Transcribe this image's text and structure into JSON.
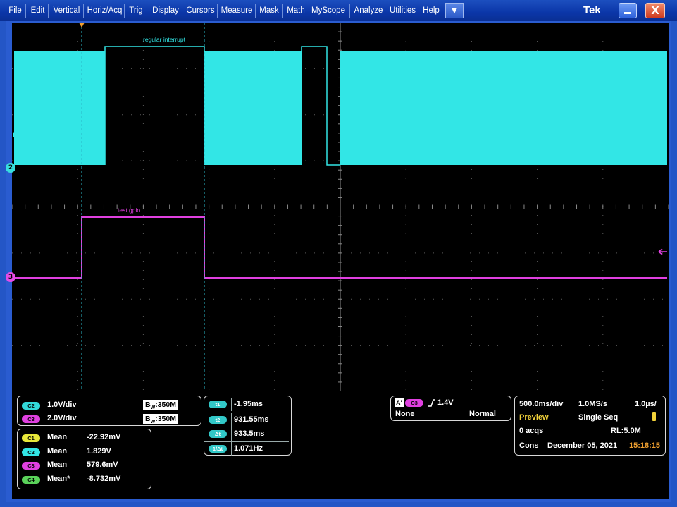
{
  "menu": {
    "items": [
      "File",
      "Edit",
      "Vertical",
      "Horiz/Acq",
      "Trig",
      "Display",
      "Cursors",
      "Measure",
      "Mask",
      "Math",
      "MyScope",
      "Analyze",
      "Utilities",
      "Help"
    ],
    "dropdown_glyph": "▼",
    "brand": "Tek",
    "minimize_icon": "minimize-icon",
    "close_glyph": "X"
  },
  "colors": {
    "ch2": "#32e6e6",
    "ch3": "#e040e0",
    "ch1": "#e8e83a",
    "ch4": "#5ad25a"
  },
  "waveform": {
    "ch2_label": "regular interrupt",
    "ch3_label": "test gpio",
    "ch2_marker": "2",
    "ch3_marker": "3"
  },
  "channels": {
    "c2": {
      "pill": "C2",
      "scale": "1.0V/div",
      "bw": "350M",
      "bw_prefix": "B",
      "bw_sub": "W"
    },
    "c3": {
      "pill": "C3",
      "scale": "2.0V/div",
      "bw": "350M",
      "bw_prefix": "B",
      "bw_sub": "W"
    }
  },
  "measurements": [
    {
      "pill": "C1",
      "label": "Mean",
      "value": "-22.92mV"
    },
    {
      "pill": "C2",
      "label": "Mean",
      "value": "1.829V"
    },
    {
      "pill": "C3",
      "label": "Mean",
      "value": "579.6mV"
    },
    {
      "pill": "C4",
      "label": "Mean*",
      "value": "-8.732mV"
    }
  ],
  "cursors": [
    {
      "pill": "t1",
      "value": "-1.95ms"
    },
    {
      "pill": "t2",
      "value": "931.55ms"
    },
    {
      "pill": "Δt",
      "value": "933.5ms"
    },
    {
      "pill": "1/Δt",
      "value": "1.071Hz"
    }
  ],
  "trigger": {
    "a_label": "A'",
    "source": "C3",
    "level": "1.4V",
    "coupling": "None",
    "mode": "Normal"
  },
  "acquisition": {
    "time_div": "500.0ms/div",
    "sample_rate": "1.0MS/s",
    "resolution": "1.0µs/",
    "state": "Preview",
    "seq": "Single Seq",
    "acqs": "0 acqs",
    "record_length": "RL:5.0M",
    "mode": "Cons",
    "date": "December 05, 2021",
    "time": "15:18:15"
  }
}
